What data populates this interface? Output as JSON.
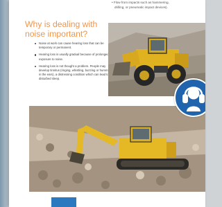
{
  "top_bullet": {
    "line1": "• Flow from impacts such as hammering,",
    "line2": "drilling, or pneumatic impact devices)."
  },
  "heading": "Why is dealing with noise important?",
  "bullets": [
    "Noise at work can cause hearing loss that can be temporary or permanent.",
    "Hearing loss is usually gradual because of prolonged exposure to noise.",
    "Hearing loss is not thought a problem. People may develop tinnitus (ringing, whistling, buzzing or humming in the ears), a distressing condition which can lead to disturbed sleep."
  ],
  "icons": {
    "ear_protection": "ear-protection-icon"
  },
  "colors": {
    "heading": "#f0954a",
    "badge": "#1f64ad",
    "page_tab": "#2c79c0"
  },
  "page_tab": ""
}
